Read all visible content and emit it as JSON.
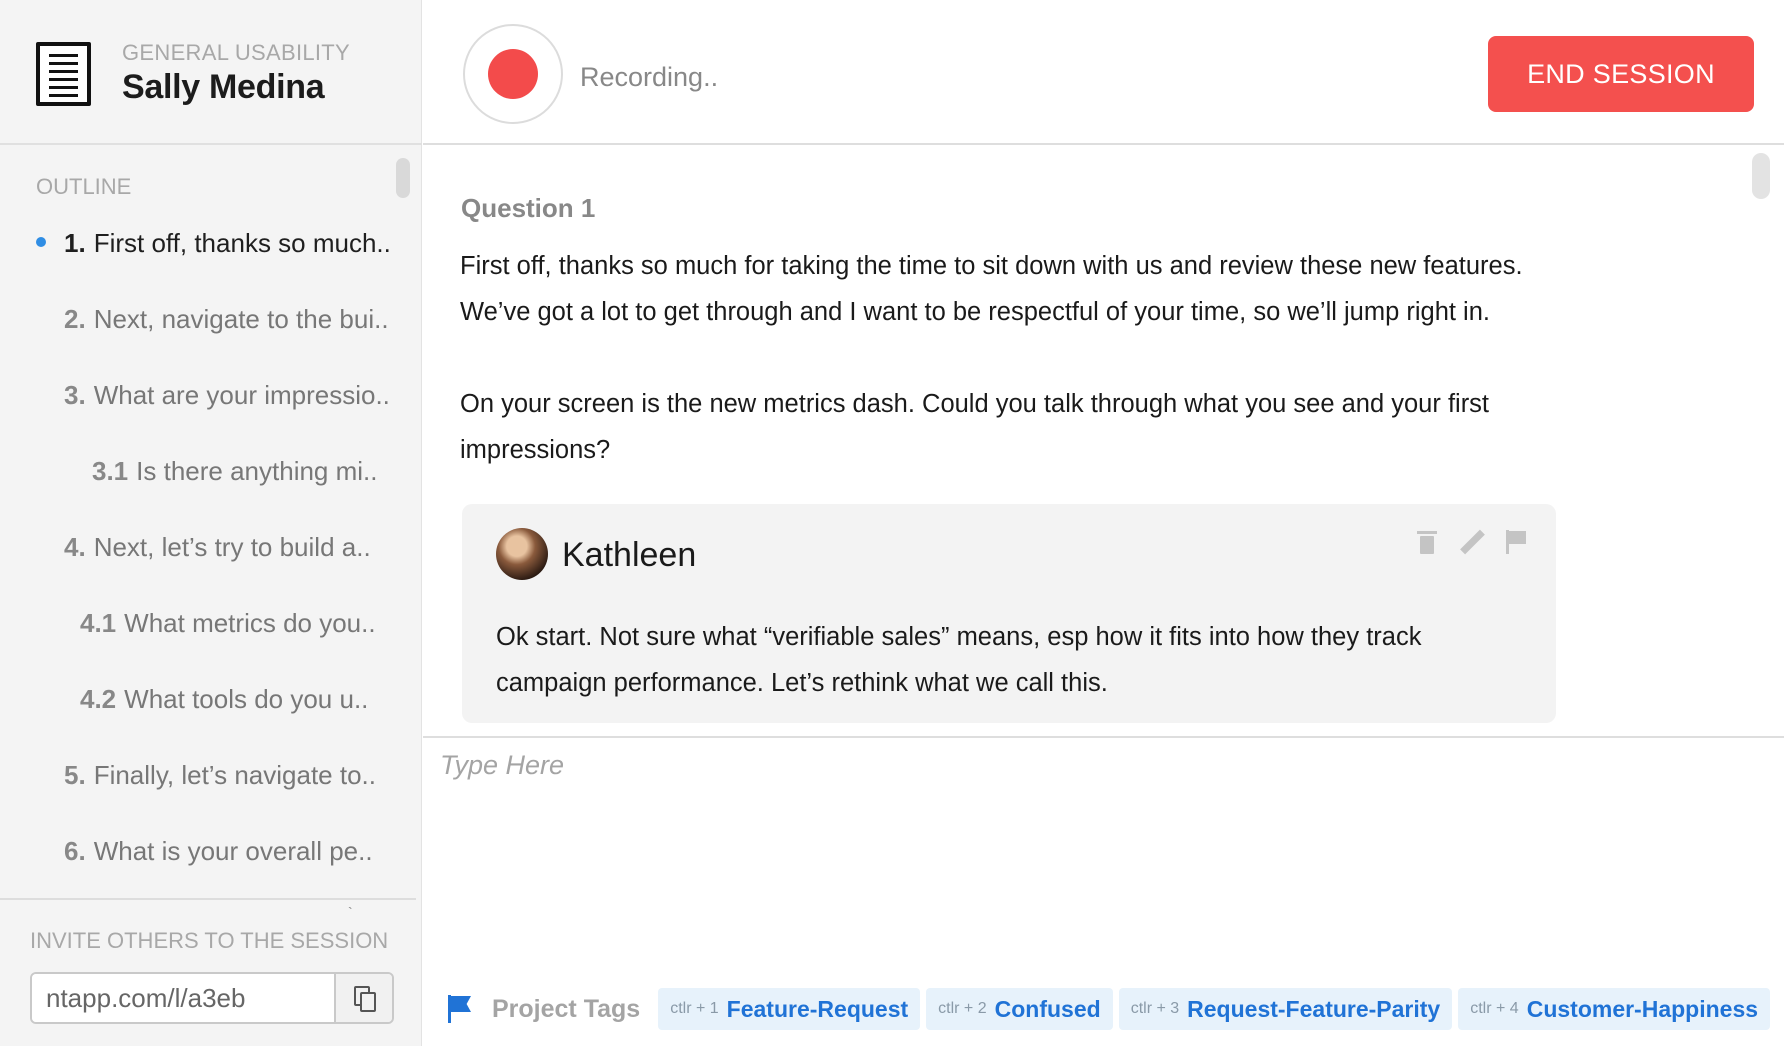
{
  "sidebar": {
    "category": "GENERAL USABILITY",
    "participant": "Sally Medina",
    "outline_label": "OUTLINE",
    "outline": [
      {
        "num": "1.",
        "text": "First off, thanks so much..",
        "active": true
      },
      {
        "num": "2.",
        "text": "Next, navigate to the bui.."
      },
      {
        "num": "3.",
        "text": "What are your impressio.."
      },
      {
        "num": "3.1",
        "text": "Is there anything mi.."
      },
      {
        "num": "4.",
        "text": "Next, let’s try to build a.."
      },
      {
        "num": "4.1",
        "text": "What metrics do you.."
      },
      {
        "num": "4.2",
        "text": "What tools do you u.."
      },
      {
        "num": "5.",
        "text": "Finally, let’s navigate to.."
      },
      {
        "num": "6.",
        "text": "What is your overall pe.."
      }
    ],
    "invite_label": "INVITE OTHERS TO THE SESSION",
    "invite_link": "ntapp.com/l/a3eb",
    "tiny_mark": "`"
  },
  "header": {
    "status": "Recording..",
    "end_button": "END SESSION",
    "record_color": "#f34b4b"
  },
  "question": {
    "title": "Question 1",
    "paragraphs": [
      "First off, thanks so much for taking the time to sit down with us and review these new features. We’ve got a lot to get through and I want to be respectful of your time, so we’ll jump right in.",
      "On your screen is the new metrics dash. Could you talk through what you see and your first impressions?"
    ]
  },
  "note": {
    "author": "Kathleen",
    "text": "Ok start. Not sure what “verifiable sales” means, esp how it fits into how they track campaign performance. Let’s rethink what we call this.",
    "actions": [
      "trash-icon",
      "pencil-icon",
      "flag-icon"
    ]
  },
  "compose": {
    "placeholder": "Type Here"
  },
  "tags": {
    "label": "Project Tags",
    "items": [
      {
        "shortcut": "ctlr + 1",
        "name": "Feature-Request"
      },
      {
        "shortcut": "ctlr + 2",
        "name": "Confused"
      },
      {
        "shortcut": "ctlr + 3",
        "name": "Request-Feature-Parity"
      },
      {
        "shortcut": "ctlr + 4",
        "name": "Customer-Happiness"
      }
    ]
  },
  "colors": {
    "accent_red": "#f4504e",
    "accent_blue": "#2073d6",
    "active_dot": "#2f8de4"
  }
}
